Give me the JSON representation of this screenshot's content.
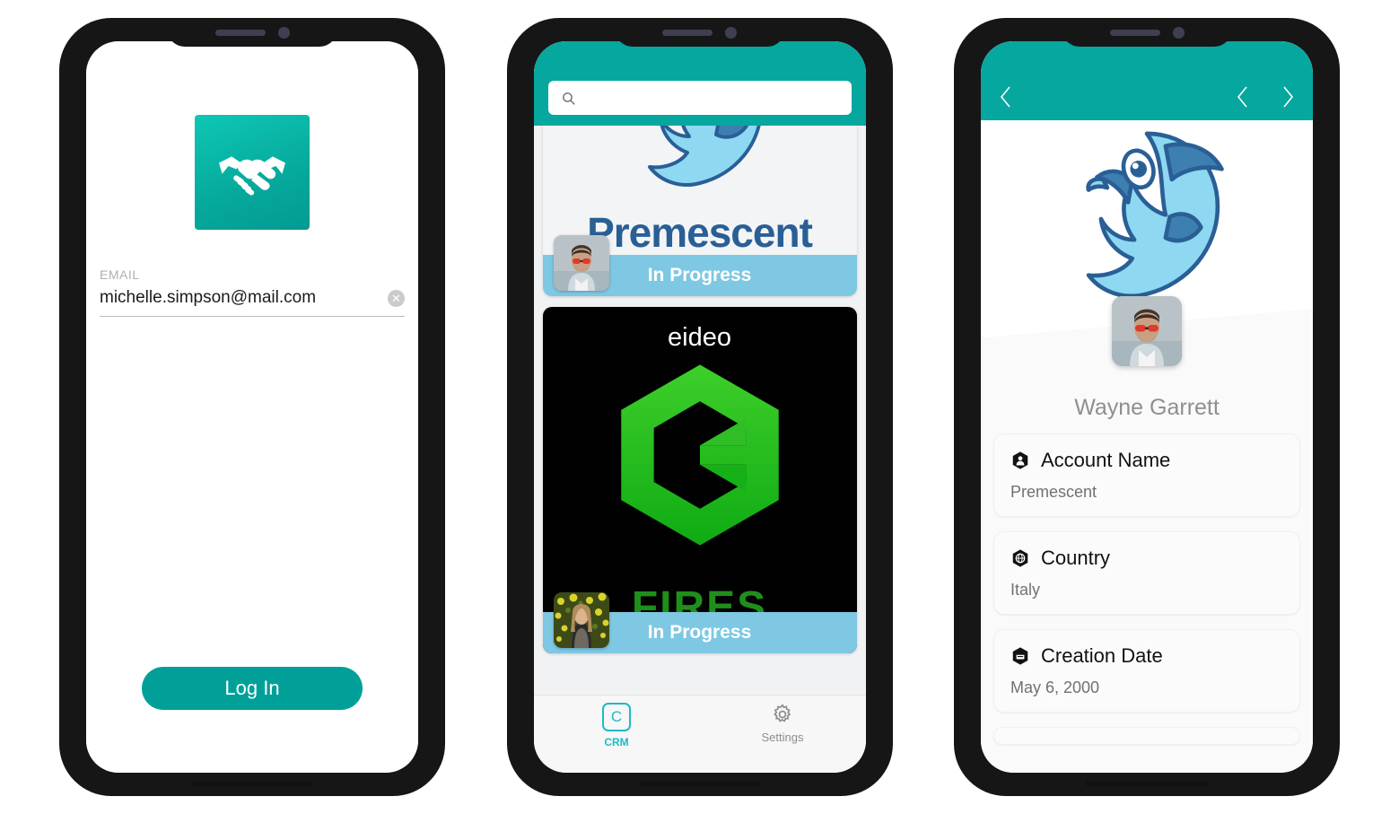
{
  "screens": {
    "login": {
      "name": "login-screen",
      "logo_icon": "handshake-icon",
      "logo_color": "#06a99c",
      "email": {
        "label": "EMAIL",
        "value": "michelle.simpson@mail.com",
        "placeholder": "",
        "clear_icon": "clear-circle-icon"
      },
      "login_button": "Log In",
      "login_button_color": "#00a098"
    },
    "crm": {
      "name": "crm-list-screen",
      "header_color": "#06a79e",
      "search": {
        "icon": "search-icon",
        "value": "",
        "placeholder": ""
      },
      "cards": [
        {
          "brand": "Premescent",
          "brand_logo": "dolphin-logo",
          "status": "In Progress",
          "status_color": "#7ec8e3",
          "avatar": "man-with-red-sunglasses-avatar",
          "theme": "light"
        },
        {
          "brand": "eideo",
          "brand_logo": "green-hexagon-e-logo",
          "subtitle": "FIRES",
          "status": "In Progress",
          "status_color": "#7ec8e3",
          "avatar": "woman-in-yellow-field-avatar",
          "theme": "dark"
        }
      ],
      "tabs": [
        {
          "label": "CRM",
          "icon": "crm-badge-icon",
          "active": true
        },
        {
          "label": "Settings",
          "icon": "gear-icon",
          "active": false
        }
      ]
    },
    "detail": {
      "name": "account-detail-screen",
      "header_color": "#06a79e",
      "nav": {
        "back_icon": "chevron-left-icon",
        "prev_icon": "chevron-left-icon",
        "next_icon": "chevron-right-icon"
      },
      "hero_logo": "dolphin-logo",
      "avatar": "man-with-red-sunglasses-avatar",
      "person_name": "Wayne Garrett",
      "fields": [
        {
          "icon": "person-hexagon-icon",
          "label": "Account Name",
          "value": "Premescent"
        },
        {
          "icon": "globe-hexagon-icon",
          "label": "Country",
          "value": "Italy"
        },
        {
          "icon": "calendar-hexagon-icon",
          "label": "Creation Date",
          "value": "May 6, 2000"
        }
      ]
    }
  }
}
